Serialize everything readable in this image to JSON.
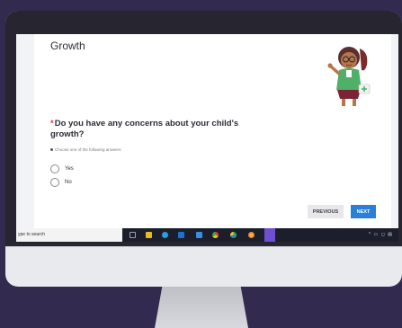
{
  "form": {
    "section_title": "Growth",
    "question_required_mark": "*",
    "question_text": "Do you have any concerns about your child's growth?",
    "hint": "Choose one of the following answers",
    "options": [
      {
        "label": "Yes",
        "selected": false
      },
      {
        "label": "No",
        "selected": false
      }
    ],
    "previous_label": "PREVIOUS",
    "next_label": "NEXT"
  },
  "taskbar": {
    "search_text": "ype to search",
    "icons": [
      "task-view-icon",
      "file-explorer-icon",
      "edge-icon",
      "mail-icon",
      "store-icon",
      "chrome-icon",
      "chrome-alt-icon",
      "firefox-icon",
      "app-icon"
    ],
    "tray_text": "^ ▭ ◻ ▤"
  },
  "colors": {
    "background": "#322a4f",
    "accent": "#2b7fd8",
    "required": "#e03a3a"
  }
}
